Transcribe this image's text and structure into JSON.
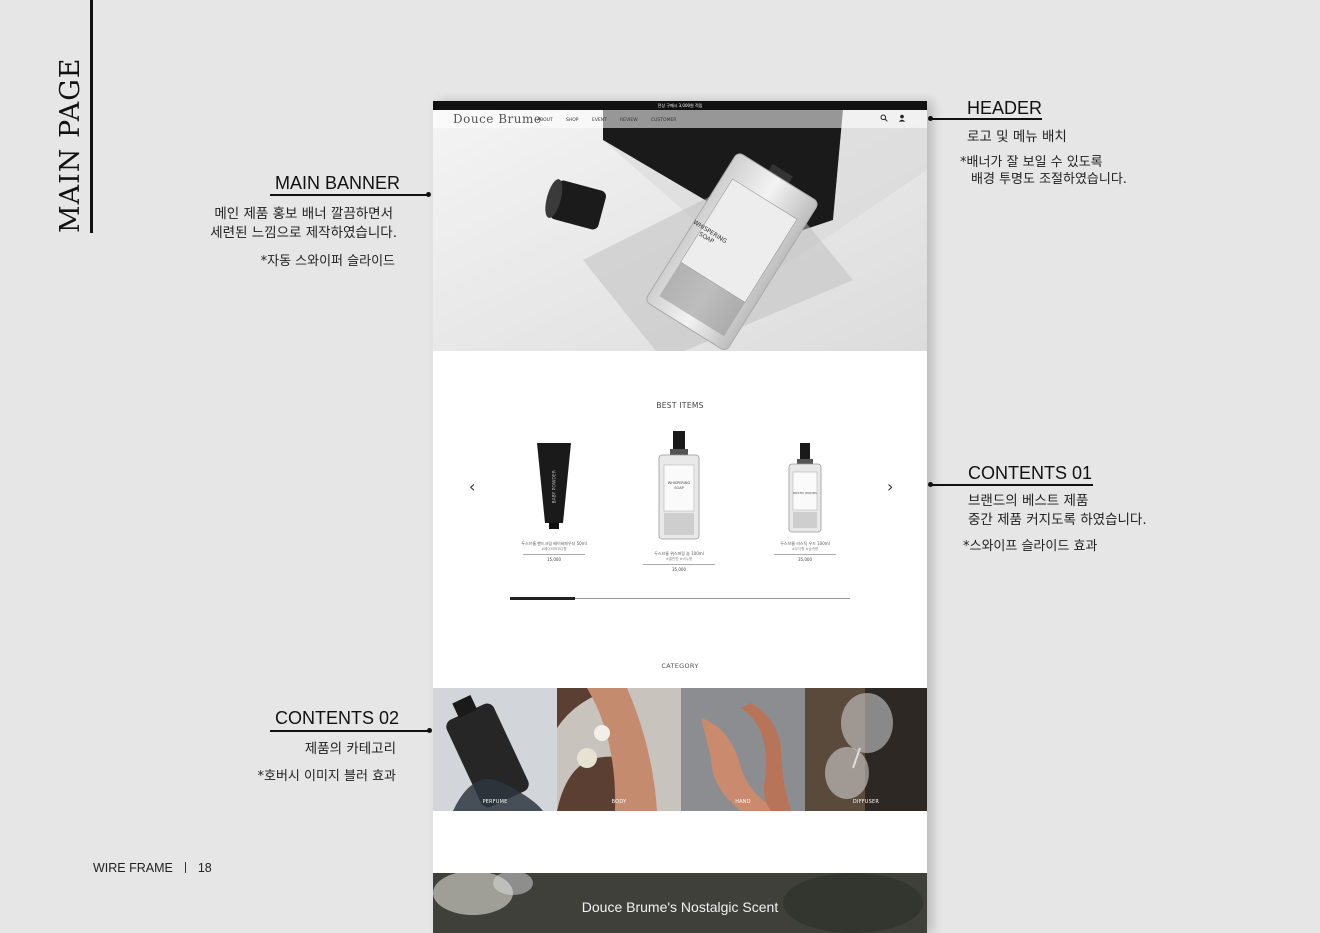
{
  "page": {
    "side_title": "MAIN PAGE",
    "footer": {
      "label": "WIRE FRAME",
      "page_number": "18"
    }
  },
  "annotations": {
    "header": {
      "title": "HEADER",
      "lines": [
        "로고 및 메뉴 배치"
      ],
      "notes": [
        "*배너가 잘 보일 수 있도록",
        "배경 투명도 조절하였습니다."
      ]
    },
    "main_banner": {
      "title": "MAIN BANNER",
      "lines": [
        "메인 제품 홍보 배너 깔끔하면서",
        "세련된 느낌으로 제작하였습니다."
      ],
      "notes": [
        "*자동 스와이퍼 슬라이드"
      ]
    },
    "contents_01": {
      "title": "CONTENTS 01",
      "lines": [
        "브랜드의 베스트 제품",
        "중간 제품 커지도록 하였습니다."
      ],
      "notes": [
        "*스와이프 슬라이드 효과"
      ]
    },
    "contents_02": {
      "title": "CONTENTS 02",
      "lines": [
        "제품의 카테고리"
      ],
      "notes": [
        "*호버시 이미지 블러 효과"
      ]
    }
  },
  "mockup": {
    "top_notice": "전상 구매시 3,000원 적립",
    "logo": "Douce Brume",
    "nav": [
      "ABOUT",
      "SHOP",
      "EVENT",
      "REVIEW",
      "CUSTOMER"
    ],
    "icons": [
      "search-icon",
      "user-icon"
    ],
    "banner_bottle_label": [
      "WHISPERING",
      "SOAP"
    ],
    "best_items_title": "BEST ITEMS",
    "products": [
      {
        "name": "두스브룸 핸드크림 베이비파우더 50ml",
        "sub": "#베이비파우더향",
        "price": "15,000",
        "tube_label": "BABY POWDER"
      },
      {
        "name": "두스브룸 위스퍼링 솝 100ml",
        "sub": "#클린한 #비누향",
        "price": "35,000",
        "label": [
          "WHISPERING",
          "SOAP"
        ]
      },
      {
        "name": "두스브룸 러스틱 우즈 100ml",
        "sub": "#우디향 #숲속향",
        "price": "35,000",
        "label": [
          "RUSTIC WOODS"
        ]
      }
    ],
    "slider_progress": 0.19,
    "category_title": "CATEGORY",
    "categories": [
      "PERFUME",
      "BODY",
      "HAND",
      "DIFFUSER"
    ],
    "scent_title": "Douce Brume's Nostalgic Scent"
  },
  "colors": {
    "background": "#e6e6e6",
    "ink": "#111111",
    "mock_bg": "#ffffff",
    "topbar": "#111111"
  }
}
